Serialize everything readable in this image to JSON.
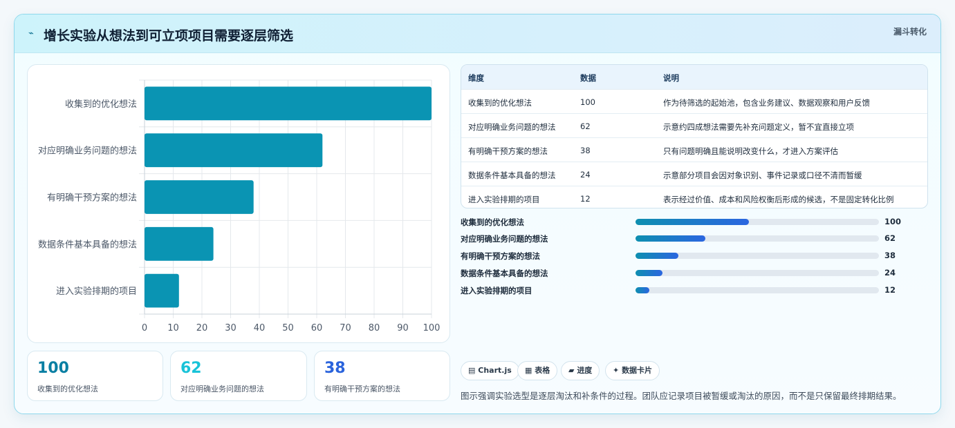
{
  "header": {
    "title": "增长实验从想法到可立项项目需要逐层筛选",
    "title_icon": "⌁",
    "tag": "漏斗转化"
  },
  "chart_data": {
    "type": "bar",
    "orientation": "horizontal",
    "categories": [
      "收集到的优化想法",
      "对应明确业务问题的想法",
      "有明确干预方案的想法",
      "数据条件基本具备的想法",
      "进入实验排期的项目"
    ],
    "values": [
      100,
      62,
      38,
      24,
      12
    ],
    "xlim": [
      0,
      100
    ],
    "xticks": [
      0,
      10,
      20,
      30,
      40,
      50,
      60,
      70,
      80,
      90,
      100
    ],
    "grid": true,
    "bar_color": "#0a94b3"
  },
  "stats": [
    {
      "value": "100",
      "label": "收集到的优化想法",
      "color": "#0a7fa3"
    },
    {
      "value": "62",
      "label": "对应明确业务问题的想法",
      "color": "#19c3d8"
    },
    {
      "value": "38",
      "label": "有明确干预方案的想法",
      "color": "#2a63dc"
    }
  ],
  "table": {
    "headers": [
      "维度",
      "数据",
      "说明"
    ],
    "rows": [
      [
        "收集到的优化想法",
        "100",
        "作为待筛选的起始池，包含业务建议、数据观察和用户反馈"
      ],
      [
        "对应明确业务问题的想法",
        "62",
        "示意约四成想法需要先补充问题定义，暂不宜直接立项"
      ],
      [
        "有明确干预方案的想法",
        "38",
        "只有问题明确且能说明改变什么，才进入方案评估"
      ],
      [
        "数据条件基本具备的想法",
        "24",
        "示意部分项目会因对象识别、事件记录或口径不清而暂缓"
      ],
      [
        "进入实验排期的项目",
        "12",
        "表示经过价值、成本和风险权衡后形成的候选，不是固定转化比例"
      ]
    ]
  },
  "progress": [
    {
      "label": "收集到的优化想法",
      "value": 100,
      "fraction": 0.465
    },
    {
      "label": "对应明确业务问题的想法",
      "value": 62,
      "fraction": 0.288
    },
    {
      "label": "有明确干预方案的想法",
      "value": 38,
      "fraction": 0.177
    },
    {
      "label": "数据条件基本具备的想法",
      "value": 24,
      "fraction": 0.112
    },
    {
      "label": "进入实验排期的项目",
      "value": 12,
      "fraction": 0.056
    }
  ],
  "chips": [
    {
      "icon": "▤",
      "label": "Chart.js"
    },
    {
      "icon": "▦",
      "label": "表格"
    },
    {
      "icon": "▰",
      "label": "进度"
    },
    {
      "icon": "✦",
      "label": "数据卡片"
    }
  ],
  "note": "图示强调实验选型是逐层淘汰和补条件的过程。团队应记录项目被暂缓或淘汰的原因，而不是只保留最终排期结果。"
}
